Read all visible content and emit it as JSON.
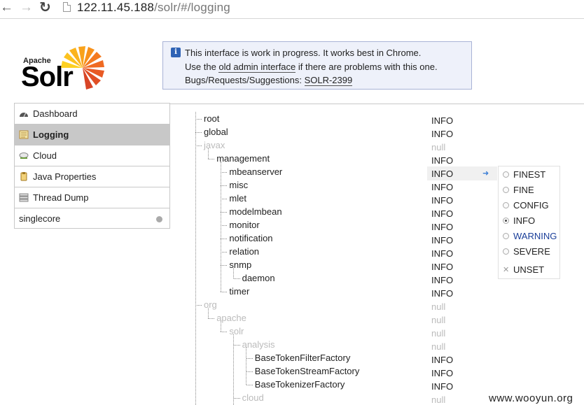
{
  "browser": {
    "url_host": "122.11.45.188",
    "url_path": "/solr/#/logging"
  },
  "header": {
    "logo_small": "Apache",
    "logo_big": "Solr",
    "notice": {
      "line1": "This interface is work in progress. It works best in Chrome.",
      "line2_pre": "Use the ",
      "line2_link": "old admin interface",
      "line2_post": " if there are problems with this one.",
      "line3_pre": "Bugs/Requests/Suggestions: ",
      "line3_link": "SOLR-2399"
    }
  },
  "sidebar": {
    "items": [
      {
        "label": "Dashboard",
        "icon": "dashboard-icon"
      },
      {
        "label": "Logging",
        "icon": "logging-icon",
        "active": true
      },
      {
        "label": "Cloud",
        "icon": "cloud-icon"
      },
      {
        "label": "Java Properties",
        "icon": "java-properties-icon"
      },
      {
        "label": "Thread Dump",
        "icon": "thread-dump-icon"
      }
    ],
    "core": {
      "label": "singlecore"
    }
  },
  "loggers": [
    {
      "name": "root",
      "level": "INFO",
      "muted": false
    },
    {
      "name": "global",
      "level": "INFO",
      "muted": false
    },
    {
      "name": "javax",
      "level": "null",
      "muted": true
    },
    {
      "name": "management",
      "level": "INFO",
      "muted": false
    },
    {
      "name": "mbeanserver",
      "level": "INFO",
      "muted": false
    },
    {
      "name": "misc",
      "level": "INFO",
      "muted": false
    },
    {
      "name": "mlet",
      "level": "INFO",
      "muted": false
    },
    {
      "name": "modelmbean",
      "level": "INFO",
      "muted": false
    },
    {
      "name": "monitor",
      "level": "INFO",
      "muted": false
    },
    {
      "name": "notification",
      "level": "INFO",
      "muted": false
    },
    {
      "name": "relation",
      "level": "INFO",
      "muted": false
    },
    {
      "name": "snmp",
      "level": "INFO",
      "muted": false
    },
    {
      "name": "daemon",
      "level": "INFO",
      "muted": false
    },
    {
      "name": "timer",
      "level": "INFO",
      "muted": false
    },
    {
      "name": "org",
      "level": "null",
      "muted": true
    },
    {
      "name": "apache",
      "level": "null",
      "muted": true
    },
    {
      "name": "solr",
      "level": "null",
      "muted": true
    },
    {
      "name": "analysis",
      "level": "null",
      "muted": true
    },
    {
      "name": "BaseTokenFilterFactory",
      "level": "INFO",
      "muted": false
    },
    {
      "name": "BaseTokenStreamFactory",
      "level": "INFO",
      "muted": false
    },
    {
      "name": "BaseTokenizerFactory",
      "level": "INFO",
      "muted": false
    },
    {
      "name": "cloud",
      "level": "null",
      "muted": true
    }
  ],
  "level_menu": {
    "options": [
      {
        "label": "FINEST",
        "checked": false
      },
      {
        "label": "FINE",
        "checked": false
      },
      {
        "label": "CONFIG",
        "checked": false
      },
      {
        "label": "INFO",
        "checked": true
      },
      {
        "label": "WARNING",
        "checked": false,
        "hover": true
      },
      {
        "label": "SEVERE",
        "checked": false
      }
    ],
    "unset_label": "UNSET"
  },
  "watermark": "www.wooyun.org"
}
